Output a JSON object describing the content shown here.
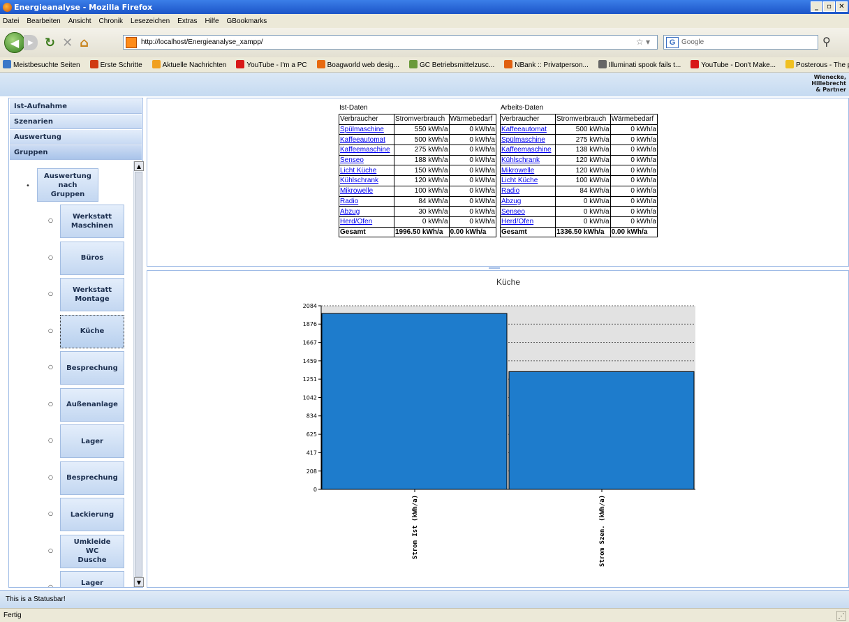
{
  "window": {
    "title": "Energieanalyse - Mozilla Firefox"
  },
  "menu": [
    "Datei",
    "Bearbeiten",
    "Ansicht",
    "Chronik",
    "Lesezeichen",
    "Extras",
    "Hilfe",
    "GBookmarks"
  ],
  "nav": {
    "url": "http://localhost/Energieanalyse_xampp/",
    "search_placeholder": "Google"
  },
  "bookmarks": [
    {
      "label": "Meistbesuchte Seiten",
      "color": "#3a78c8"
    },
    {
      "label": "Erste Schritte",
      "color": "#d03a12"
    },
    {
      "label": "Aktuelle Nachrichten",
      "color": "#f0a020"
    },
    {
      "label": "YouTube - I'm a PC",
      "color": "#d81818"
    },
    {
      "label": "Boagworld web desig...",
      "color": "#e86a10"
    },
    {
      "label": "GC Betriebsmittelzusc...",
      "color": "#6a9a3a"
    },
    {
      "label": "NBank :: Privatperson...",
      "color": "#e06010"
    },
    {
      "label": "Illuminati spook fails t...",
      "color": "#666666"
    },
    {
      "label": "YouTube - Don't Make...",
      "color": "#d81818"
    },
    {
      "label": "Posterous - The place...",
      "color": "#f0c020"
    }
  ],
  "bookmarks_more": "»",
  "brand": [
    "Wienecke,",
    "Hillebrecht",
    "& Partner"
  ],
  "sidebar": {
    "sections": [
      "Ist-Aufnahme",
      "Szenarien",
      "Auswertung",
      "Gruppen"
    ],
    "active_section": "Gruppen",
    "root_group": "Auswertung\nnach\nGruppen",
    "groups": [
      "Werkstatt\nMaschinen",
      "Büros",
      "Werkstatt\nMontage",
      "Küche",
      "Besprechung",
      "Außenanlage",
      "Lager",
      "Besprechung",
      "Lackierung",
      "Umkleide\nWC\nDusche",
      "Lager\nBühne"
    ],
    "selected_group": "Küche"
  },
  "ist_table": {
    "caption": "Ist-Daten",
    "headers": [
      "Verbraucher",
      "Stromverbrauch",
      "Wärmebedarf"
    ],
    "rows": [
      [
        "Spülmaschine",
        "550 kWh/a",
        "0 kWh/a"
      ],
      [
        "Kaffeeautomat",
        "500 kWh/a",
        "0 kWh/a"
      ],
      [
        "Kaffeemaschine",
        "275 kWh/a",
        "0 kWh/a"
      ],
      [
        "Senseo",
        "188 kWh/a",
        "0 kWh/a"
      ],
      [
        "Licht Küche",
        "150 kWh/a",
        "0 kWh/a"
      ],
      [
        "Kühlschrank",
        "120 kWh/a",
        "0 kWh/a"
      ],
      [
        "Mikrowelle",
        "100 kWh/a",
        "0 kWh/a"
      ],
      [
        "Radio",
        "84 kWh/a",
        "0 kWh/a"
      ],
      [
        "Abzug",
        "30 kWh/a",
        "0 kWh/a"
      ],
      [
        "Herd/Ofen",
        "0 kWh/a",
        "0 kWh/a"
      ]
    ],
    "total": [
      "Gesamt",
      "1996.50 kWh/a",
      "0.00 kWh/a"
    ]
  },
  "arbeits_table": {
    "caption": "Arbeits-Daten",
    "headers": [
      "Verbraucher",
      "Stromverbrauch",
      "Wärmebedarf"
    ],
    "rows": [
      [
        "Kaffeeautomat",
        "500 kWh/a",
        "0 kWh/a"
      ],
      [
        "Spülmaschine",
        "275 kWh/a",
        "0 kWh/a"
      ],
      [
        "Kaffeemaschine",
        "138 kWh/a",
        "0 kWh/a"
      ],
      [
        "Kühlschrank",
        "120 kWh/a",
        "0 kWh/a"
      ],
      [
        "Mikrowelle",
        "120 kWh/a",
        "0 kWh/a"
      ],
      [
        "Licht Küche",
        "100 kWh/a",
        "0 kWh/a"
      ],
      [
        "Radio",
        "84 kWh/a",
        "0 kWh/a"
      ],
      [
        "Abzug",
        "0 kWh/a",
        "0 kWh/a"
      ],
      [
        "Senseo",
        "0 kWh/a",
        "0 kWh/a"
      ],
      [
        "Herd/Ofen",
        "0 kWh/a",
        "0 kWh/a"
      ]
    ],
    "total": [
      "Gesamt",
      "1336.50 kWh/a",
      "0.00 kWh/a"
    ]
  },
  "chart_data": {
    "type": "bar",
    "title": "Küche",
    "categories": [
      "Strom Ist (kWh/a)",
      "Strom Szen. (kWh/a)"
    ],
    "values": [
      1996.5,
      1336.5
    ],
    "yticks": [
      0,
      208,
      417,
      625,
      834,
      1042,
      1251,
      1459,
      1667,
      1876,
      2084
    ],
    "ylim": [
      0,
      2084
    ],
    "bar_color": "#1e7ccc",
    "bg_color": "#e2e2e2",
    "grid": true
  },
  "statusbar": "This is a Statusbar!",
  "firefox_status": "Fertig"
}
